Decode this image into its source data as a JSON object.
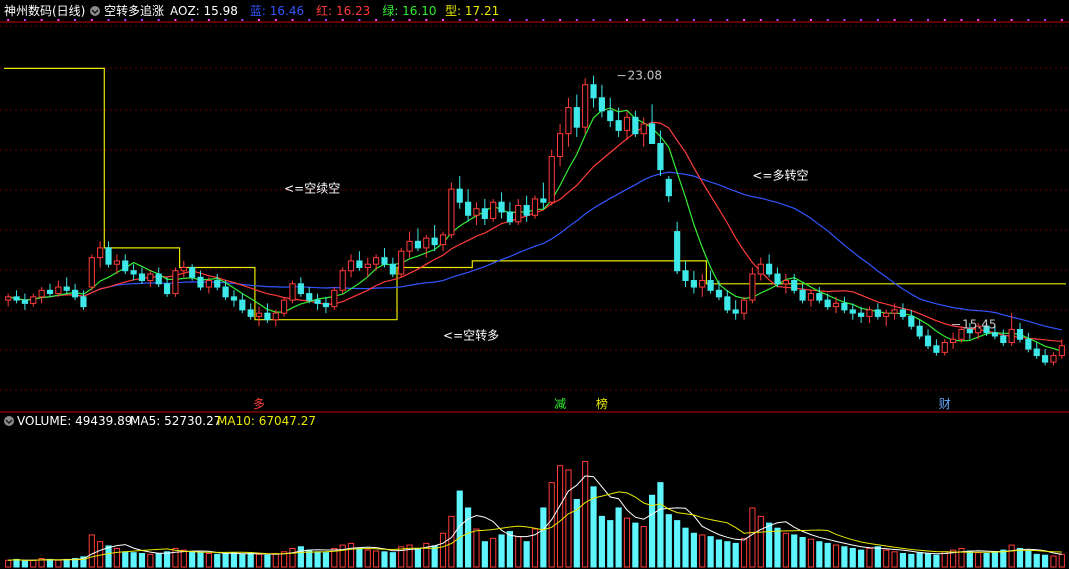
{
  "window": {
    "stock_name": "神州数码(日线)",
    "indicator_name": "空转多追涨",
    "indicator_values": [
      {
        "label": "AOZ:",
        "value": "15.98",
        "color": "#ffffff"
      },
      {
        "label": "蓝:",
        "value": "16.46",
        "color": "#3355ff"
      },
      {
        "label": "红:",
        "value": "16.23",
        "color": "#ff3b3b"
      },
      {
        "label": "绿:",
        "value": "16.10",
        "color": "#33ee33"
      },
      {
        "label": "型:",
        "value": "17.21",
        "color": "#e8e800"
      }
    ]
  },
  "annotations": [
    {
      "text": "<=空续空",
      "xi": 33,
      "y": 19.5
    },
    {
      "text": "<=空转多",
      "xi": 52,
      "y": 15.0
    },
    {
      "text": "<=多转空",
      "xi": 89,
      "y": 19.9
    }
  ],
  "price_labels": [
    {
      "text": "23.08",
      "xi": 73,
      "y": 23.08
    },
    {
      "text": "15.45",
      "xi": 113,
      "y": 15.45
    }
  ],
  "signals": [
    {
      "text": "多",
      "xi": 30,
      "color": "#ff3b3b"
    },
    {
      "text": "减",
      "xi": 66,
      "color": "#33ee33"
    },
    {
      "text": "榜",
      "xi": 71,
      "color": "#e8e800"
    },
    {
      "text": "财",
      "xi": 112,
      "color": "#66aaff"
    }
  ],
  "volume_panel": {
    "label": "VOLUME:",
    "value": "49439.89",
    "ma5_label": "MA5:",
    "ma5_value": "52730.27",
    "ma10_label": "MA10:",
    "ma10_value": "67047.27"
  },
  "chart_data": {
    "type": "candlestick",
    "colors": {
      "up": "#ff3b3b",
      "down": "#3ee8e8",
      "volume_up": "#ff3b3b",
      "volume_down": "#5ff5ff",
      "blue": "#3355ff",
      "red": "#ff3b3b",
      "green": "#33ee33",
      "type_line": "#e8e800"
    },
    "ylim": [
      13.2,
      24.6
    ],
    "volume_ylim": [
      0,
      160000
    ],
    "candles": [
      [
        16.2,
        16.4,
        16.0,
        16.3
      ],
      [
        16.3,
        16.5,
        16.1,
        16.2
      ],
      [
        16.2,
        16.4,
        15.9,
        16.1
      ],
      [
        16.1,
        16.4,
        16.0,
        16.3
      ],
      [
        16.3,
        16.6,
        16.1,
        16.5
      ],
      [
        16.5,
        16.7,
        16.3,
        16.4
      ],
      [
        16.4,
        16.8,
        16.3,
        16.6
      ],
      [
        16.6,
        16.9,
        16.4,
        16.5
      ],
      [
        16.5,
        16.7,
        16.2,
        16.3
      ],
      [
        16.3,
        16.5,
        15.9,
        16.0
      ],
      [
        16.6,
        17.6,
        16.5,
        17.5
      ],
      [
        17.5,
        18.0,
        17.2,
        17.8
      ],
      [
        17.8,
        18.0,
        17.2,
        17.3
      ],
      [
        17.3,
        17.6,
        17.0,
        17.4
      ],
      [
        17.4,
        17.6,
        17.0,
        17.1
      ],
      [
        17.1,
        17.3,
        16.8,
        17.0
      ],
      [
        17.0,
        17.2,
        16.7,
        16.8
      ],
      [
        16.8,
        17.1,
        16.6,
        17.0
      ],
      [
        17.0,
        17.2,
        16.6,
        16.7
      ],
      [
        16.7,
        16.9,
        16.3,
        16.4
      ],
      [
        16.4,
        17.2,
        16.3,
        17.1
      ],
      [
        17.1,
        17.4,
        16.9,
        17.2
      ],
      [
        17.2,
        17.3,
        16.8,
        16.9
      ],
      [
        16.9,
        17.1,
        16.5,
        16.6
      ],
      [
        16.6,
        16.9,
        16.4,
        16.8
      ],
      [
        16.8,
        17.0,
        16.5,
        16.6
      ],
      [
        16.6,
        16.8,
        16.2,
        16.3
      ],
      [
        16.3,
        16.5,
        16.0,
        16.2
      ],
      [
        16.2,
        16.4,
        15.8,
        15.9
      ],
      [
        15.9,
        16.1,
        15.6,
        15.7
      ],
      [
        15.7,
        16.0,
        15.4,
        15.8
      ],
      [
        15.8,
        16.1,
        15.5,
        15.6
      ],
      [
        15.6,
        15.9,
        15.4,
        15.8
      ],
      [
        15.8,
        16.3,
        15.7,
        16.2
      ],
      [
        16.2,
        16.8,
        16.1,
        16.7
      ],
      [
        16.7,
        16.9,
        16.3,
        16.4
      ],
      [
        16.4,
        16.6,
        16.1,
        16.2
      ],
      [
        16.2,
        16.4,
        15.9,
        16.1
      ],
      [
        16.1,
        16.3,
        15.8,
        16.0
      ],
      [
        16.0,
        16.6,
        15.9,
        16.5
      ],
      [
        16.5,
        17.2,
        16.4,
        17.1
      ],
      [
        17.1,
        17.6,
        16.9,
        17.4
      ],
      [
        17.4,
        17.7,
        17.1,
        17.2
      ],
      [
        17.2,
        17.5,
        16.9,
        17.3
      ],
      [
        17.3,
        17.6,
        17.1,
        17.5
      ],
      [
        17.5,
        17.8,
        17.2,
        17.3
      ],
      [
        17.3,
        17.5,
        16.9,
        17.0
      ],
      [
        17.0,
        17.8,
        16.9,
        17.7
      ],
      [
        17.7,
        18.3,
        17.5,
        18.0
      ],
      [
        18.0,
        18.4,
        17.7,
        17.8
      ],
      [
        17.8,
        18.2,
        17.5,
        18.1
      ],
      [
        18.1,
        18.5,
        17.7,
        17.9
      ],
      [
        17.9,
        18.3,
        17.7,
        18.2
      ],
      [
        18.2,
        19.8,
        18.1,
        19.6
      ],
      [
        19.6,
        20.0,
        19.0,
        19.2
      ],
      [
        19.2,
        19.6,
        18.6,
        18.8
      ],
      [
        18.8,
        19.2,
        18.5,
        19.0
      ],
      [
        19.0,
        19.3,
        18.5,
        18.7
      ],
      [
        18.7,
        19.3,
        18.6,
        19.2
      ],
      [
        19.2,
        19.5,
        18.7,
        18.9
      ],
      [
        18.9,
        19.2,
        18.5,
        18.6
      ],
      [
        18.6,
        19.3,
        18.5,
        19.1
      ],
      [
        19.1,
        19.4,
        18.6,
        18.8
      ],
      [
        18.8,
        19.4,
        18.7,
        19.3
      ],
      [
        19.3,
        19.8,
        19.0,
        19.2
      ],
      [
        19.2,
        20.8,
        19.1,
        20.6
      ],
      [
        20.6,
        21.6,
        20.3,
        21.3
      ],
      [
        21.3,
        22.4,
        20.9,
        22.1
      ],
      [
        22.1,
        22.5,
        21.2,
        21.5
      ],
      [
        21.5,
        23.0,
        21.3,
        22.8
      ],
      [
        22.8,
        23.08,
        22.1,
        22.4
      ],
      [
        22.4,
        22.8,
        21.8,
        22.0
      ],
      [
        22.0,
        22.4,
        21.5,
        21.7
      ],
      [
        21.7,
        22.1,
        21.2,
        21.4
      ],
      [
        21.4,
        22.0,
        21.1,
        21.8
      ],
      [
        21.8,
        22.0,
        21.2,
        21.3
      ],
      [
        21.3,
        21.8,
        20.9,
        21.6
      ],
      [
        21.6,
        22.2,
        21.3,
        21.0
      ],
      [
        21.0,
        21.4,
        20.0,
        20.2
      ],
      [
        19.9,
        20.0,
        19.2,
        19.4
      ],
      [
        18.3,
        18.6,
        17.0,
        17.1
      ],
      [
        17.1,
        17.4,
        16.6,
        16.8
      ],
      [
        16.8,
        17.1,
        16.4,
        16.6
      ],
      [
        16.6,
        17.0,
        16.3,
        16.8
      ],
      [
        16.8,
        17.1,
        16.4,
        16.5
      ],
      [
        16.5,
        16.8,
        16.2,
        16.3
      ],
      [
        16.3,
        16.5,
        15.8,
        15.9
      ],
      [
        15.9,
        16.2,
        15.6,
        15.8
      ],
      [
        15.8,
        16.3,
        15.6,
        16.2
      ],
      [
        16.2,
        17.2,
        16.1,
        17.0
      ],
      [
        17.0,
        17.5,
        16.8,
        17.3
      ],
      [
        17.3,
        17.6,
        16.9,
        17.0
      ],
      [
        17.0,
        17.2,
        16.6,
        16.7
      ],
      [
        16.7,
        17.0,
        16.4,
        16.8
      ],
      [
        16.8,
        17.0,
        16.4,
        16.5
      ],
      [
        16.5,
        16.7,
        16.1,
        16.2
      ],
      [
        16.2,
        16.5,
        16.0,
        16.4
      ],
      [
        16.4,
        16.6,
        16.1,
        16.2
      ],
      [
        16.2,
        16.4,
        15.9,
        16.0
      ],
      [
        16.0,
        16.3,
        15.8,
        16.1
      ],
      [
        16.1,
        16.3,
        15.8,
        15.9
      ],
      [
        15.9,
        16.1,
        15.6,
        15.8
      ],
      [
        15.8,
        16.0,
        15.5,
        15.7
      ],
      [
        15.7,
        16.0,
        15.5,
        15.9
      ],
      [
        15.9,
        16.1,
        15.6,
        15.7
      ],
      [
        15.7,
        15.9,
        15.4,
        15.8
      ],
      [
        15.8,
        16.1,
        15.6,
        15.9
      ],
      [
        15.9,
        16.1,
        15.6,
        15.7
      ],
      [
        15.7,
        15.9,
        15.3,
        15.4
      ],
      [
        15.4,
        15.6,
        15.0,
        15.1
      ],
      [
        15.1,
        15.3,
        14.7,
        14.8
      ],
      [
        14.8,
        15.0,
        14.5,
        14.6
      ],
      [
        14.6,
        15.0,
        14.5,
        14.9
      ],
      [
        14.9,
        15.2,
        14.7,
        15.0
      ],
      [
        15.0,
        15.4,
        14.9,
        15.3
      ],
      [
        15.3,
        15.5,
        15.0,
        15.2
      ],
      [
        15.2,
        15.5,
        15.0,
        15.4
      ],
      [
        15.4,
        15.6,
        15.1,
        15.2
      ],
      [
        15.2,
        15.4,
        15.0,
        15.1
      ],
      [
        15.1,
        15.3,
        14.8,
        14.9
      ],
      [
        14.9,
        15.8,
        14.8,
        15.3
      ],
      [
        15.3,
        15.5,
        14.9,
        15.0
      ],
      [
        15.0,
        15.2,
        14.6,
        14.7
      ],
      [
        14.7,
        14.9,
        14.4,
        14.5
      ],
      [
        14.5,
        14.7,
        14.2,
        14.3
      ],
      [
        14.3,
        14.6,
        14.2,
        14.5
      ],
      [
        14.5,
        15.0,
        14.4,
        14.8
      ]
    ],
    "volume": [
      8,
      9,
      7,
      8,
      10,
      9,
      8,
      9,
      10,
      12,
      38,
      30,
      25,
      22,
      18,
      17,
      16,
      15,
      16,
      18,
      22,
      20,
      18,
      17,
      16,
      15,
      16,
      17,
      15,
      16,
      15,
      14,
      16,
      18,
      22,
      24,
      20,
      18,
      17,
      22,
      26,
      28,
      22,
      20,
      19,
      18,
      17,
      24,
      26,
      22,
      28,
      25,
      40,
      60,
      90,
      70,
      45,
      30,
      34,
      38,
      42,
      36,
      30,
      45,
      70,
      100,
      120,
      115,
      80,
      125,
      95,
      60,
      55,
      70,
      58,
      52,
      48,
      85,
      100,
      62,
      55,
      46,
      40,
      38,
      36,
      32,
      30,
      28,
      34,
      70,
      60,
      52,
      46,
      40,
      38,
      35,
      33,
      30,
      28,
      26,
      24,
      22,
      20,
      22,
      24,
      20,
      18,
      16,
      15,
      17,
      16,
      14,
      18,
      20,
      22,
      19,
      17,
      16,
      18,
      20,
      26,
      22,
      19,
      15,
      14,
      13,
      15
    ],
    "volume_up_is_open_bar": true
  }
}
